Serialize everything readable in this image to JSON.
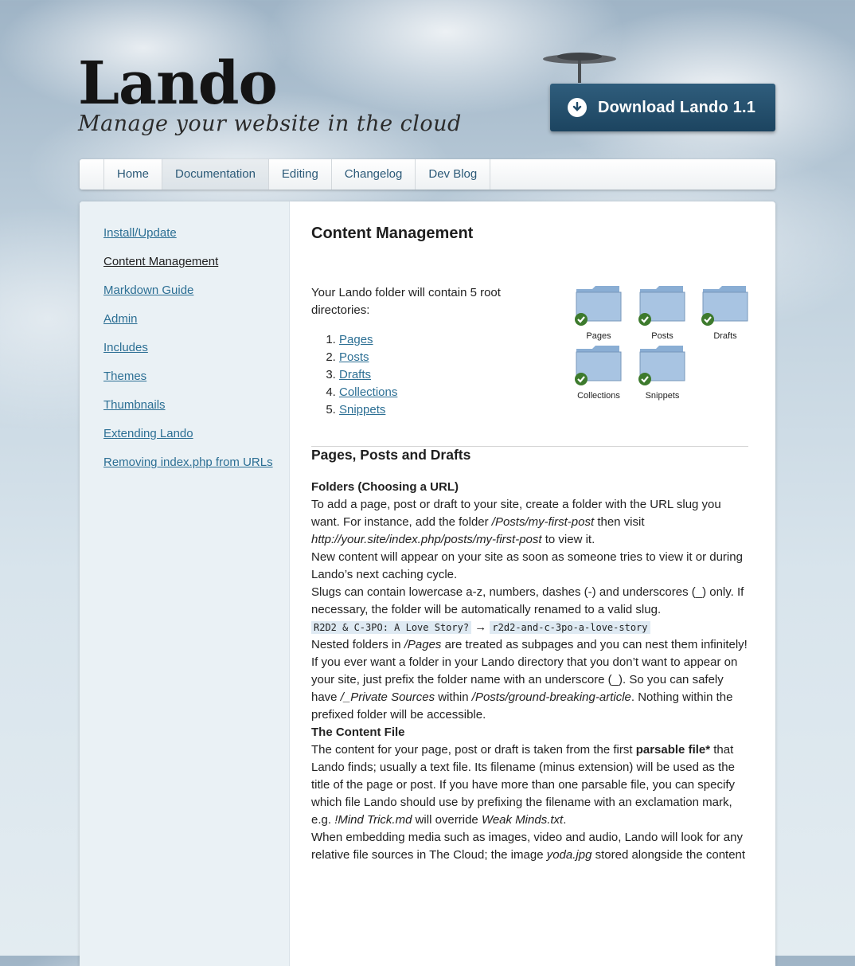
{
  "header": {
    "logo_title": "Lando",
    "logo_tagline": "Manage your website in the cloud",
    "download_label": "Download Lando 1.1"
  },
  "nav": {
    "items": [
      "Home",
      "Documentation",
      "Editing",
      "Changelog",
      "Dev Blog"
    ],
    "active": "Documentation"
  },
  "sidebar": {
    "items": [
      "Install/Update",
      "Content Management",
      "Markdown Guide",
      "Admin",
      "Includes",
      "Themes",
      "Thumbnails",
      "Extending Lando",
      "Removing index.php from URLs"
    ],
    "current": "Content Management"
  },
  "content": {
    "title": "Content Management",
    "intro": "Your Lando folder will contain 5 root directories:",
    "root_dirs": [
      "Pages",
      "Posts",
      "Drafts",
      "Collections",
      "Snippets"
    ],
    "folder_icons": [
      "Pages",
      "Posts",
      "Drafts",
      "Collections",
      "Snippets"
    ],
    "section_title": "Pages, Posts and Drafts",
    "folders_heading": "Folders (Choosing a URL)",
    "p1_a": "To add a page, post or draft to your site, create a folder with the URL slug you want. For instance, add the folder ",
    "p1_path": "/Posts/my-first-post",
    "p1_b": " then visit ",
    "p1_url": "http://your.site/index.php/posts/my-first-post",
    "p1_c": " to view it.",
    "p2": "New content will appear on your site as soon as someone tries to view it or during Lando’s next caching cycle.",
    "p3": "Slugs can contain lowercase a-z, numbers, dashes (-) and underscores (_) only. If necessary, the folder will be automatically renamed to a valid slug.",
    "code_from": "R2D2 & C-3PO: A Love Story?",
    "code_arrow": "→",
    "code_to": "r2d2-and-c-3po-a-love-story",
    "p4_a": "Nested folders in ",
    "p4_path": "/Pages",
    "p4_b": " are treated as subpages and you can nest them infinitely!",
    "p5_a": "If you ever want a folder in your Lando directory that you don’t want to appear on your site, just prefix the folder name with an underscore (_). So you can safely have ",
    "p5_path1": "/_Private Sources",
    "p5_b": " within ",
    "p5_path2": "/Posts/ground-breaking-article",
    "p5_c": ". Nothing within the prefixed folder will be accessible.",
    "content_file_heading": "The Content File",
    "p6_a": "The content for your page, post or draft is taken from the first ",
    "p6_bold": "parsable file*",
    "p6_b": " that Lando finds; usually a text file. Its filename (minus extension) will be used as the title of the page or post. If you have more than one parsable file, you can specify which file Lando should use by prefixing the filename with an exclamation mark, e.g. ",
    "p6_file1": "!Mind Trick.md",
    "p6_c": " will override ",
    "p6_file2": "Weak Minds.txt",
    "p6_d": ".",
    "p7_a": "When embedding media such as images, video and audio, Lando will look for any relative file sources in The Cloud; the image ",
    "p7_file": "yoda.jpg",
    "p7_b": " stored alongside the content"
  }
}
